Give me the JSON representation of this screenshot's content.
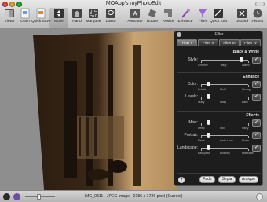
{
  "window": {
    "title": "MOApp's myPhotoEdit"
  },
  "toolbar": {
    "items": [
      {
        "label": "Views",
        "icon": "views-icon"
      },
      {
        "label": "Open",
        "icon": "open-icon"
      },
      {
        "label": "Quick Save",
        "icon": "quick-save-icon"
      },
      {
        "label": "Move",
        "icon": "move-icon"
      },
      {
        "label": "Hand",
        "icon": "hand-icon"
      },
      {
        "label": "Marquee",
        "icon": "marquee-icon"
      },
      {
        "label": "Lasso",
        "icon": "lasso-icon"
      },
      {
        "label": "Annotate",
        "icon": "annotate-icon"
      },
      {
        "label": "Rotate",
        "icon": "rotate-icon"
      },
      {
        "label": "Resize",
        "icon": "resize-icon"
      },
      {
        "label": "Enhance",
        "icon": "enhance-icon"
      },
      {
        "label": "Filter",
        "icon": "filter-icon"
      },
      {
        "label": "Quick Edit",
        "icon": "quick-edit-icon"
      },
      {
        "label": "Discard",
        "icon": "discard-icon"
      },
      {
        "label": "History",
        "icon": "history-icon"
      }
    ]
  },
  "filter_panel": {
    "title": "Filter",
    "tabs": [
      "Filter I",
      "Filter II",
      "Filter III",
      "Filter IV"
    ],
    "active_tab": "Filter I",
    "sections": {
      "bw": "Black & White",
      "enhance": "Enhance",
      "effects": "Effects"
    },
    "rows": [
      {
        "label": "Style:",
        "options": [
          "Chrome",
          "Tasty",
          "Warm"
        ],
        "checked": true,
        "value": 0.85
      },
      {
        "label": "Color:",
        "options": [
          "Subtle",
          "Vivid",
          "Strong"
        ],
        "checked": true,
        "value": 0.15
      },
      {
        "label": "Levels:",
        "options": [
          "Nutty",
          "Holly",
          "Bally"
        ],
        "checked": true,
        "value": 0.15
      },
      {
        "label": "Misc:",
        "options": [
          "Deep",
          "Still",
          "Party"
        ],
        "checked": true,
        "value": 0.15
      },
      {
        "label": "Portrait:",
        "options": [
          "Nana",
          "Lady-Love",
          "Blobs"
        ],
        "checked": true,
        "value": 0.15
      },
      {
        "label": "Landscape:",
        "options": [
          "Backyard",
          "Bushies",
          "Mascarie"
        ],
        "checked": true,
        "value": 0.15
      }
    ],
    "buttons": {
      "fade": "Fade",
      "sepia": "Sepia",
      "antique": "Antique"
    },
    "help": "?",
    "check_mark": "✓"
  },
  "status": {
    "text": "IMG_0311 - JPEG image - 2186 x 1726 pixel (Current)"
  },
  "colors": {
    "sepia_dark": "#2a1c10",
    "sepia_light": "#c8a474"
  }
}
